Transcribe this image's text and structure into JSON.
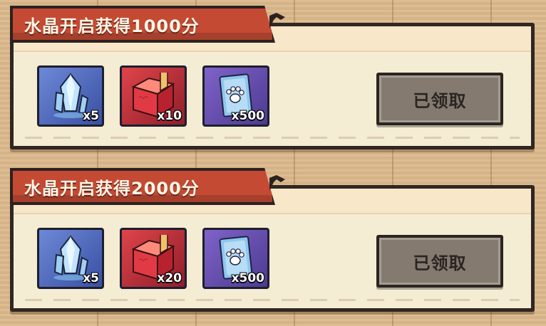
{
  "tasks": [
    {
      "title": "水晶开启获得1000分",
      "rewards": [
        {
          "icon": "crystal-icon",
          "count": "x5"
        },
        {
          "icon": "red-chest-icon",
          "count": "x10"
        },
        {
          "icon": "paw-card-icon",
          "count": "x500"
        }
      ],
      "button_label": "已领取"
    },
    {
      "title": "水晶开启获得2000分",
      "rewards": [
        {
          "icon": "crystal-icon",
          "count": "x5"
        },
        {
          "icon": "red-chest-icon",
          "count": "x20"
        },
        {
          "icon": "paw-card-icon",
          "count": "x500"
        }
      ],
      "button_label": "已领取"
    }
  ],
  "colors": {
    "ribbon": "#c44a34",
    "card_bg": "#f5ecd4",
    "button_claimed": "#847a70",
    "background": "#dcb98c"
  }
}
